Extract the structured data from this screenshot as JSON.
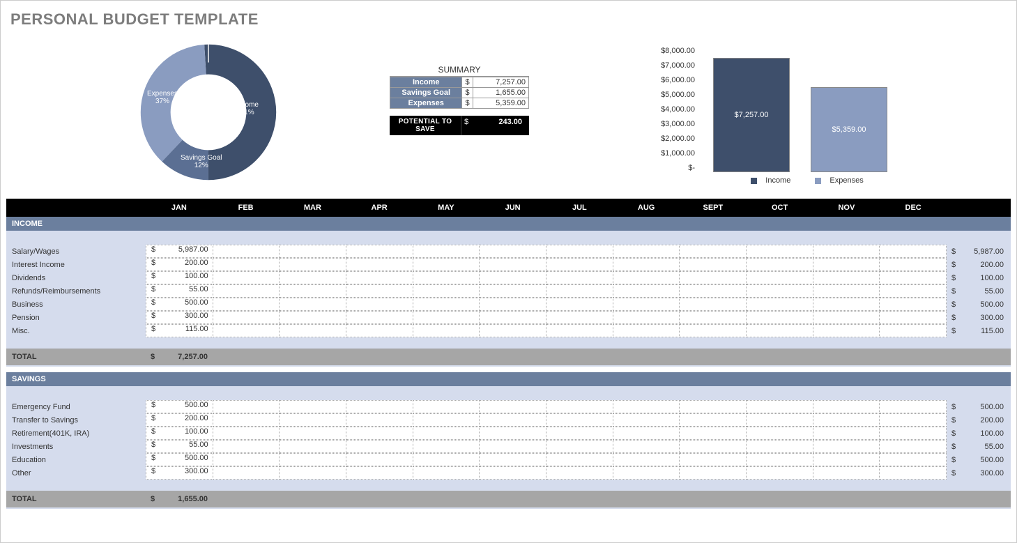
{
  "title": "PERSONAL BUDGET TEMPLATE",
  "donut": {
    "income": {
      "label": "Income",
      "percent": "51%",
      "value": 51,
      "color": "#3e4f6b"
    },
    "savings": {
      "label": "Savings Goal",
      "percent": "12%",
      "value": 12,
      "color": "#5b6f93"
    },
    "expenses": {
      "label": "Expenses",
      "percent": "37%",
      "value": 37,
      "color": "#8a9cc0"
    }
  },
  "summary": {
    "header": "SUMMARY",
    "rows": [
      {
        "label": "Income",
        "amount": "7,257.00"
      },
      {
        "label": "Savings Goal",
        "amount": "1,655.00"
      },
      {
        "label": "Expenses",
        "amount": "5,359.00"
      }
    ],
    "potential": {
      "label": "POTENTIAL TO SAVE",
      "amount": "243.00"
    }
  },
  "barChart": {
    "yTicks": [
      "$8,000.00",
      "$7,000.00",
      "$6,000.00",
      "$5,000.00",
      "$4,000.00",
      "$3,000.00",
      "$2,000.00",
      "$1,000.00",
      "$-"
    ],
    "bars": {
      "income": "$7,257.00",
      "expenses": "$5,359.00"
    },
    "legend": {
      "income": "Income",
      "expenses": "Expenses"
    }
  },
  "chart_data": [
    {
      "type": "pie",
      "title": "",
      "series": [
        {
          "name": "Income",
          "value": 51,
          "color": "#3e4f6b"
        },
        {
          "name": "Savings Goal",
          "value": 12,
          "color": "#5b6f93"
        },
        {
          "name": "Expenses",
          "value": 37,
          "color": "#8a9cc0"
        }
      ]
    },
    {
      "type": "bar",
      "title": "",
      "categories": [
        "Income",
        "Expenses"
      ],
      "values": [
        7257.0,
        5359.0
      ],
      "ylim": [
        0,
        8000
      ],
      "xlabel": "",
      "ylabel": ""
    }
  ],
  "months": [
    "JAN",
    "FEB",
    "MAR",
    "APR",
    "MAY",
    "JUN",
    "JUL",
    "AUG",
    "SEPT",
    "OCT",
    "NOV",
    "DEC"
  ],
  "sections": [
    {
      "title": "INCOME",
      "rows": [
        {
          "label": "Salary/Wages",
          "jan": "5,987.00",
          "total": "5,987.00"
        },
        {
          "label": "Interest Income",
          "jan": "200.00",
          "total": "200.00"
        },
        {
          "label": "Dividends",
          "jan": "100.00",
          "total": "100.00"
        },
        {
          "label": "Refunds/Reimbursements",
          "jan": "55.00",
          "total": "55.00"
        },
        {
          "label": "Business",
          "jan": "500.00",
          "total": "500.00"
        },
        {
          "label": "Pension",
          "jan": "300.00",
          "total": "300.00"
        },
        {
          "label": "Misc.",
          "jan": "115.00",
          "total": "115.00"
        }
      ],
      "totalLabel": "TOTAL",
      "totalJan": "7,257.00"
    },
    {
      "title": "SAVINGS",
      "rows": [
        {
          "label": "Emergency Fund",
          "jan": "500.00",
          "total": "500.00"
        },
        {
          "label": "Transfer to Savings",
          "jan": "200.00",
          "total": "200.00"
        },
        {
          "label": "Retirement(401K, IRA)",
          "jan": "100.00",
          "total": "100.00"
        },
        {
          "label": "Investments",
          "jan": "55.00",
          "total": "55.00"
        },
        {
          "label": "Education",
          "jan": "500.00",
          "total": "500.00"
        },
        {
          "label": "Other",
          "jan": "300.00",
          "total": "300.00"
        }
      ],
      "totalLabel": "TOTAL",
      "totalJan": "1,655.00"
    }
  ]
}
